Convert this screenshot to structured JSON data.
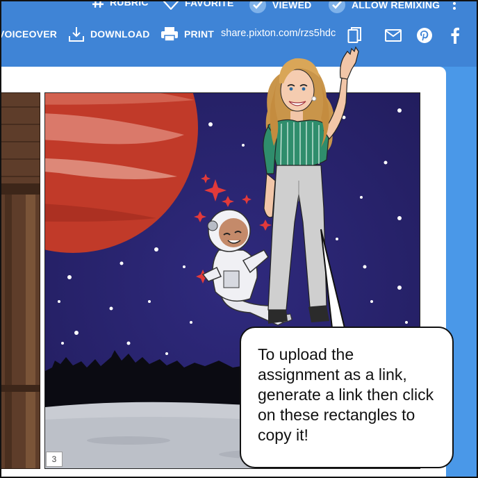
{
  "toolbar": {
    "row1": [
      {
        "name": "rubric",
        "label": "RUBRIC",
        "icon": "hash-icon"
      },
      {
        "name": "favorite",
        "label": "FAVORITE",
        "icon": "heart-icon"
      },
      {
        "name": "viewed",
        "label": "VIEWED",
        "icon": "check-circle-icon"
      },
      {
        "name": "allow-remixing",
        "label": "ALLOW REMIXING",
        "icon": "check-circle-icon"
      }
    ],
    "row2": [
      {
        "name": "voiceover",
        "label": "VOICEOVER"
      },
      {
        "name": "download",
        "label": "DOWNLOAD",
        "icon": "download-icon"
      },
      {
        "name": "print",
        "label": "PRINT",
        "icon": "printer-icon"
      }
    ],
    "share_link": "share.pixton.com/rzs5hdc",
    "share_icons": [
      "copy-icon",
      "mail-icon",
      "pinterest-icon",
      "facebook-icon"
    ],
    "more_icon": "more-vertical-icon"
  },
  "comic": {
    "panel_number": "3",
    "bubble_text": "To upload the assignment as a link, generate a link then click on these rectangles to copy it!"
  },
  "colors": {
    "toolbar": "#3f84d6",
    "background": "#4a98e8",
    "space": "#2b2470",
    "planet": "#c63a2a",
    "ground": "#c9ccd3"
  }
}
